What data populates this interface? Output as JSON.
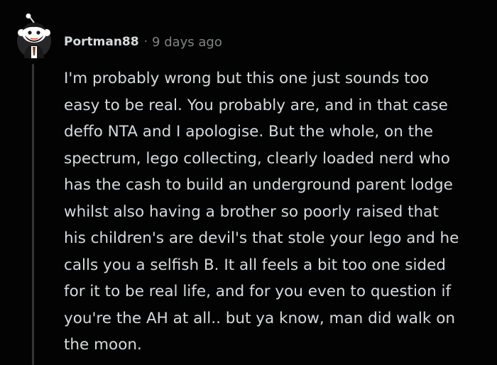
{
  "comment": {
    "username": "Portman88",
    "separator": "·",
    "timestamp": "9 days ago",
    "avatar_icon": "snoo-avatar-icon",
    "body_lines": [
      "I'm probably wrong but this one just sounds too",
      "easy to be real. You probably are, and in that case",
      "deffo NTA and I apologise. But the whole, on the",
      "spectrum, lego collecting, clearly loaded nerd who",
      "has the cash to build an underground parent lodge",
      "whilst also having a brother so poorly raised that",
      "his children's are devil's that stole your lego and he",
      "calls you a selfish B. It all feels a bit too one sided",
      "for it to be real life, and for you even to question if",
      "you're the AH at all.. but ya know, man did walk on",
      "the moon."
    ]
  },
  "colors": {
    "background": "#030303",
    "text": "#d7dadc",
    "meta": "#818384",
    "thread_line": "#343536"
  }
}
